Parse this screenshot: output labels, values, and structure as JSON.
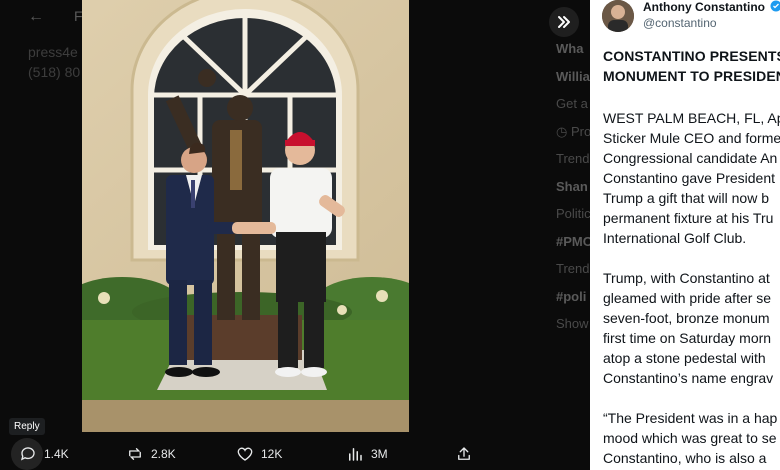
{
  "background": {
    "back_glyph": "←",
    "mid_glyph": "F",
    "line1": "press4e",
    "line2": "(518) 80",
    "right_column": [
      {
        "text": "Wha",
        "bold": true
      },
      {
        "text": "Willia",
        "bold": true
      },
      {
        "text": "Get a",
        "bold": false
      },
      {
        "text": "◷ Pro",
        "bold": false
      },
      {
        "text": "Trendi",
        "bold": false
      },
      {
        "text": "Shan",
        "bold": true
      },
      {
        "text": "Politic",
        "bold": false
      },
      {
        "text": "#PMO",
        "bold": true
      },
      {
        "text": "Trendi",
        "bold": false
      },
      {
        "text": "#poli",
        "bold": true
      },
      {
        "text": "Show",
        "bold": false
      }
    ]
  },
  "viewer": {
    "expand_icon": "double-chevron-right-icon",
    "tooltip": "Reply",
    "actions": {
      "reply_count": "1.4K",
      "repost_count": "2.8K",
      "like_count": "12K",
      "views_count": "3M"
    }
  },
  "tweet": {
    "author_name": "Anthony Constantino",
    "author_handle": "@constantino",
    "verified": true,
    "headline_lines": [
      "CONSTANTINO PRESENTS",
      "MONUMENT TO PRESIDEN"
    ],
    "paragraphs": [
      [
        "WEST PALM BEACH, FL, Ap",
        "Sticker Mule CEO and forme",
        "Congressional candidate An",
        "Constantino gave President",
        "Trump a gift that will now b",
        "permanent fixture at his Tru",
        "International Golf Club."
      ],
      [
        "Trump, with Constantino at",
        "gleamed with pride after se",
        "seven-foot, bronze monum",
        "first time on Saturday morn",
        "atop a stone pedestal with",
        "Constantino’s name engrav"
      ],
      [
        "“The President was in a hap",
        "mood which was great to se",
        "Constantino, who is also a "
      ]
    ]
  },
  "colors": {
    "accent_blue": "#1d9bf0",
    "hat_red": "#c8102e"
  }
}
